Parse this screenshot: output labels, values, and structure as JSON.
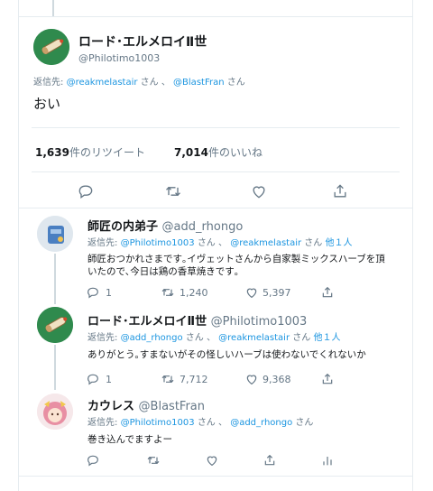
{
  "main_tweet": {
    "name": "ロード･エルメロイⅡ世",
    "handle": "@Philotimo1003",
    "reply_prefix": "返信先:",
    "reply_to": [
      "@reakmelastair",
      "@BlastFran"
    ],
    "suffix_san": "さん",
    "sep": "、",
    "text": "おい",
    "retweets_count": "1,639",
    "retweets_label": "件のリツイート",
    "likes_count": "7,014",
    "likes_label": "件のいいね"
  },
  "replies": [
    {
      "name": "師匠の内弟子",
      "handle": "@add_rhongo",
      "reply_prefix": "返信先:",
      "reply_to_1": "@Philotimo1003",
      "reply_to_2": "@reakmelastair",
      "san": "さん",
      "sep": "、",
      "others": "他１人",
      "text_line1": "師匠おつかれさまです｡イヴェットさんから自家製ミックスハーブを頂",
      "text_line2": "いたので､今日は鶏の香草焼きです｡",
      "reply_count": "1",
      "retweet_count": "1,240",
      "like_count": "5,397"
    },
    {
      "name": "ロード･エルメロイⅡ世",
      "handle": "@Philotimo1003",
      "reply_prefix": "返信先:",
      "reply_to_1": "@add_rhongo",
      "reply_to_2": "@reakmelastair",
      "san": "さん",
      "sep": "、",
      "others": "他１人",
      "text_line1": "ありがとう｡すまないがその怪しいハーブは使わないでくれないか",
      "reply_count": "1",
      "retweet_count": "7,712",
      "like_count": "9,368"
    },
    {
      "name": "カウレス",
      "handle": "@BlastFran",
      "reply_prefix": "返信先:",
      "reply_to_1": "@Philotimo1003",
      "reply_to_2": "@add_rhongo",
      "san": "さん",
      "sep": "、",
      "text_line1": "巻き込んでますよー"
    }
  ],
  "colors": {
    "link": "#1b95e0",
    "muted": "#657786",
    "border": "#e6ecf0"
  },
  "icons": [
    "reply-icon",
    "retweet-icon",
    "like-icon",
    "share-icon",
    "analytics-icon"
  ]
}
